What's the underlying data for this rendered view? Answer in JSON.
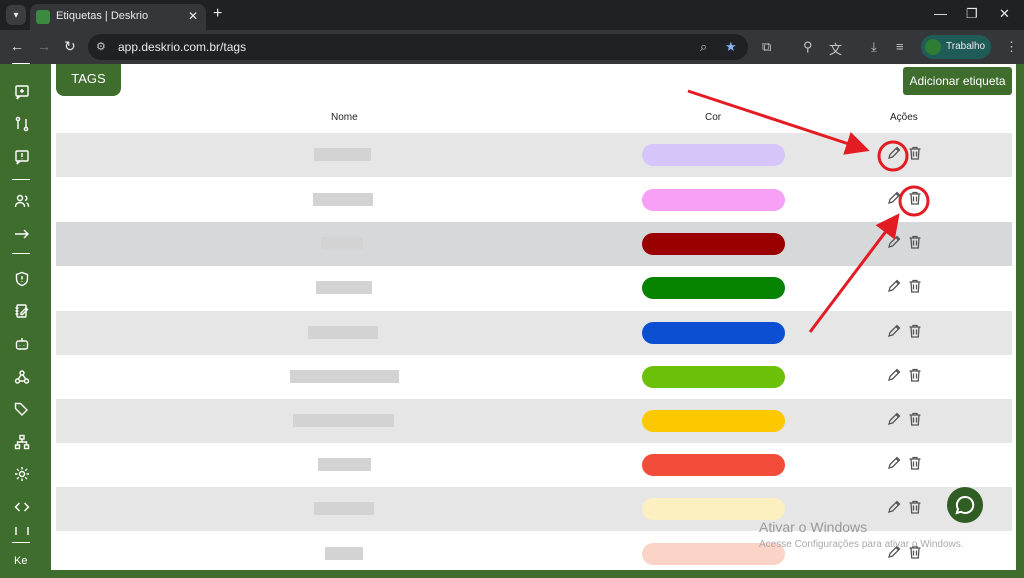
{
  "browser": {
    "tab_title": "Etiquetas | Deskrio",
    "url": "app.deskrio.com.br/tags",
    "profile_name": "Trabalho"
  },
  "page": {
    "tags_label": "TAGS",
    "add_button_label": "Adicionar etiqueta",
    "columns": [
      "Nome",
      "Cor",
      "Ações"
    ],
    "sidebar_user": "Ke"
  },
  "tags": [
    {
      "color": "#d6c5fb"
    },
    {
      "color": "#f7a0f5"
    },
    {
      "color": "#9b0000"
    },
    {
      "color": "#068400"
    },
    {
      "color": "#0c4fd3"
    },
    {
      "color": "#6bc10a"
    },
    {
      "color": "#fcc800"
    },
    {
      "color": "#f44c3b"
    },
    {
      "color": "#fdf0c0"
    },
    {
      "color": "#fcd3c7"
    }
  ],
  "watermark": {
    "title": "Ativar o Windows",
    "subtitle": "Acesse Configurações para ativar o Windows."
  },
  "colors": {
    "brand": "#3e6d2e",
    "annotation": "#e31b23"
  }
}
